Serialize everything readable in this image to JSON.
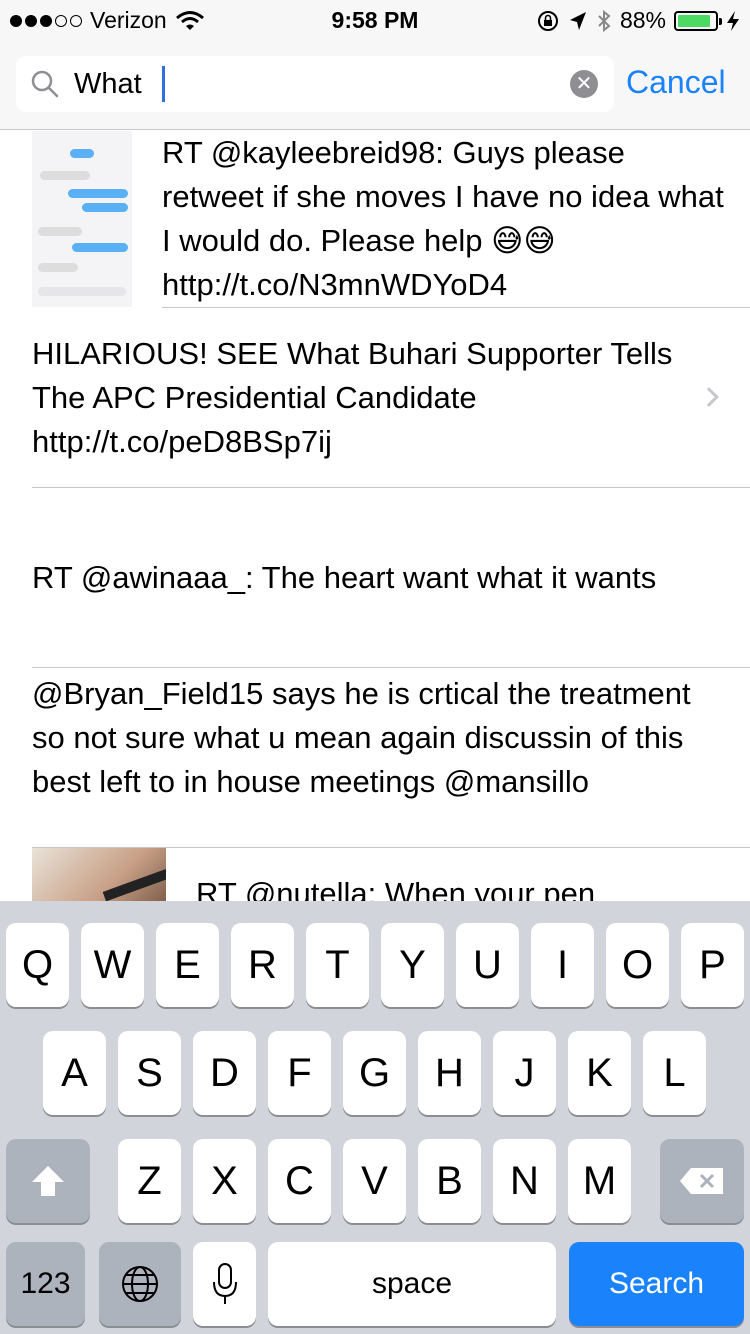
{
  "status_bar": {
    "carrier": "Verizon",
    "time": "9:58 PM",
    "battery_percent": "88%",
    "battery_level": 0.88,
    "signal_bars_filled": 3,
    "signal_bars_total": 5
  },
  "search": {
    "query": "What",
    "cancel_label": "Cancel"
  },
  "results": [
    {
      "text": "RT @kayleebreid98: Guys please retweet if she moves I have no idea what I would do. Please help 😅😅 http://t.co/N3mnWDYoD4",
      "has_thumbnail": true
    },
    {
      "text": "HILARIOUS! SEE What Buhari Supporter Tells The APC Presidential Candidate http://t.co/peD8BSp7ij",
      "has_disclosure": true
    },
    {
      "text": "RT @awinaaa_: The heart want what it wants"
    },
    {
      "text": "@Bryan_Field15 says he is crtical  the treatment so not sure what u mean again discussin of  this best left to  in house meetings @mansillo"
    },
    {
      "text": "RT @nutella: When your pen",
      "has_thumbnail": true
    }
  ],
  "keyboard": {
    "row1": [
      "Q",
      "W",
      "E",
      "R",
      "T",
      "Y",
      "U",
      "I",
      "O",
      "P"
    ],
    "row2": [
      "A",
      "S",
      "D",
      "F",
      "G",
      "H",
      "J",
      "K",
      "L"
    ],
    "row3": [
      "Z",
      "X",
      "C",
      "V",
      "B",
      "N",
      "M"
    ],
    "numbers_label": "123",
    "space_label": "space",
    "search_label": "Search"
  },
  "colors": {
    "accent": "#1a82fb",
    "battery_fill": "#4cd964",
    "keyboard_bg": "#d1d5db"
  }
}
